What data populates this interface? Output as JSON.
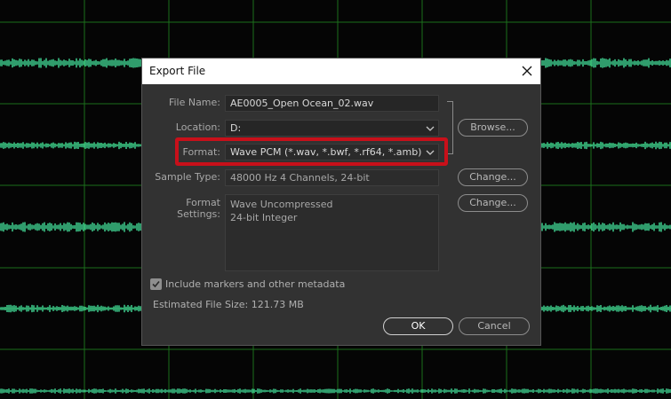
{
  "dialog": {
    "title": "Export File",
    "close_icon": "close-icon"
  },
  "form": {
    "file_name_label": "File Name:",
    "file_name_value": "AE0005_Open Ocean_02.wav",
    "location_label": "Location:",
    "location_value": "D:",
    "format_label": "Format:",
    "format_value": "Wave PCM (*.wav, *.bwf, *.rf64, *.amb)",
    "sample_type_label": "Sample Type:",
    "sample_type_value": "48000 Hz 4 Channels, 24-bit",
    "format_settings_label": "Format Settings:",
    "format_settings_lines": [
      "Wave Uncompressed",
      "24-bit Integer"
    ],
    "include_markers_label": "Include markers and other metadata",
    "include_markers_checked": true,
    "estimated_size": "Estimated File Size: 121.73 MB"
  },
  "buttons": {
    "browse": "Browse...",
    "change_sample": "Change...",
    "change_format": "Change...",
    "ok": "OK",
    "cancel": "Cancel"
  },
  "colors": {
    "highlight": "#c8101a",
    "waveform": "#3ecf8e",
    "gridline": "#1f7a1f"
  }
}
